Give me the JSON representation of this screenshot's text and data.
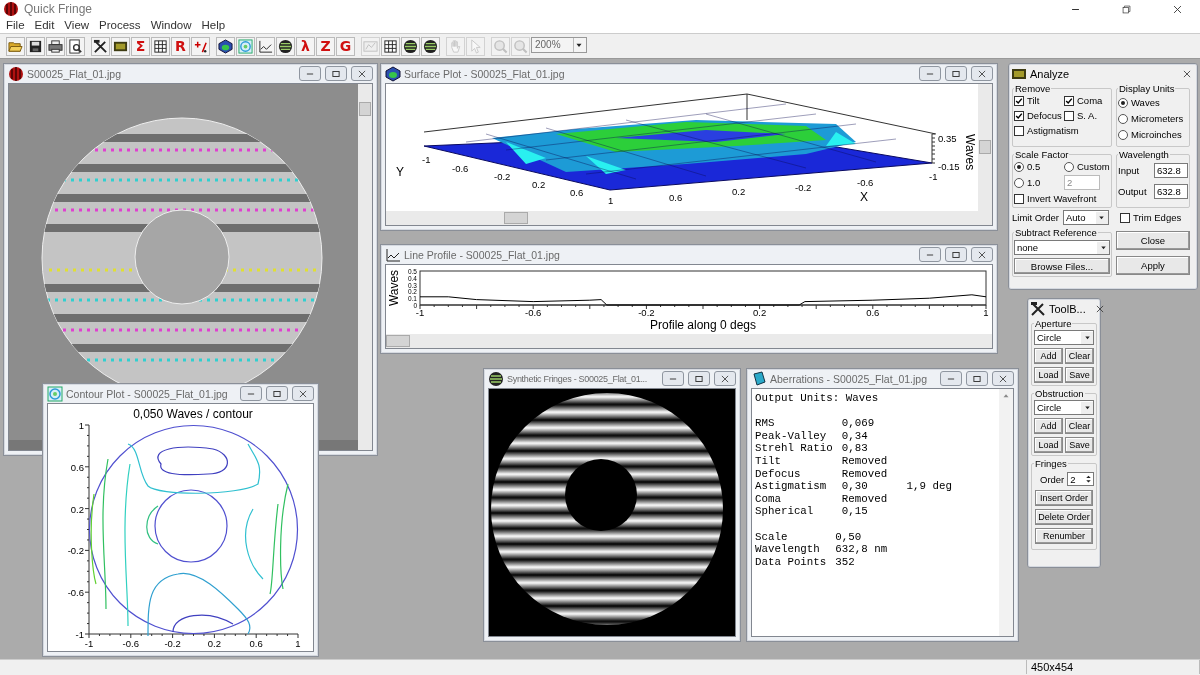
{
  "app": {
    "title": "Quick Fringe"
  },
  "menu": [
    "File",
    "Edit",
    "View",
    "Process",
    "Window",
    "Help"
  ],
  "toolbar": [
    [
      {
        "kind": "icon",
        "disabled": false
      },
      {
        "kind": "icon",
        "disabled": false
      },
      {
        "kind": "icon",
        "disabled": false
      },
      {
        "kind": "icon",
        "disabled": false
      }
    ],
    [
      {
        "kind": "icon",
        "disabled": false
      },
      {
        "kind": "icon",
        "disabled": false
      },
      {
        "kind": "glyph",
        "text": "Σ",
        "disabled": false
      },
      {
        "kind": "icon",
        "disabled": false
      },
      {
        "kind": "glyph",
        "text": "R",
        "disabled": false
      },
      {
        "kind": "icon",
        "disabled": false
      }
    ],
    [
      {
        "kind": "icon",
        "disabled": false
      },
      {
        "kind": "icon",
        "disabled": false
      },
      {
        "kind": "icon",
        "disabled": false
      },
      {
        "kind": "icon",
        "disabled": false
      },
      {
        "kind": "glyph",
        "text": "λ",
        "disabled": false
      },
      {
        "kind": "glyph",
        "text": "Z",
        "disabled": false
      },
      {
        "kind": "glyph",
        "text": "G",
        "disabled": false
      }
    ],
    [
      {
        "kind": "icon",
        "disabled": true
      },
      {
        "kind": "icon",
        "disabled": false
      },
      {
        "kind": "icon",
        "disabled": false
      },
      {
        "kind": "icon",
        "disabled": false
      }
    ],
    [
      {
        "kind": "icon",
        "disabled": true
      },
      {
        "kind": "icon",
        "disabled": true
      }
    ],
    [
      {
        "kind": "icon",
        "disabled": true
      },
      {
        "kind": "icon",
        "disabled": true
      },
      {
        "kind": "combo",
        "text": "200%",
        "disabled": true
      }
    ]
  ],
  "image_window": {
    "title": "S00025_Flat_01.jpg"
  },
  "surface_plot": {
    "title": "Surface Plot - S00025_Flat_01.jpg",
    "y_label": "Y",
    "x_label": "X",
    "z_label": "Waves",
    "y_ticks": [
      "-1",
      "-0.6",
      "-0.2",
      "0.2",
      "0.6",
      "1"
    ],
    "x_ticks": [
      "0.6",
      "0.2",
      "-0.2",
      "-0.6",
      "-1"
    ],
    "z_ticks": [
      "0.35",
      "-0.15"
    ]
  },
  "line_profile": {
    "title": "Line Profile - S00025_Flat_01.jpg",
    "chart_data": {
      "type": "line",
      "xlabel": "Profile along 0 degs",
      "ylabel": "Waves",
      "x": [
        -1,
        -0.9,
        -0.8,
        -0.6,
        -0.4,
        -0.36,
        -0.34,
        0.34,
        0.36,
        0.6,
        0.8,
        0.95,
        1
      ],
      "series": [
        {
          "color": "#000000",
          "values": [
            0.12,
            0.12,
            0.08,
            0.05,
            0.07,
            0.08,
            0,
            0,
            0.05,
            0.07,
            0.1,
            0.15,
            0.12
          ]
        }
      ],
      "xlim": [
        -1,
        1
      ],
      "ylim": [
        0,
        0.5
      ],
      "xticks": [
        -1,
        -0.6,
        -0.2,
        0.2,
        0.6,
        1
      ],
      "yticks": [
        0,
        0.1,
        0.2,
        0.3,
        0.4,
        0.5
      ]
    }
  },
  "contour_plot": {
    "title": "Contour Plot - S00025_Flat_01.jpg",
    "plot_title": "0,050 Waves / contour",
    "xticks": [
      "-1",
      "-0.6",
      "-0.2",
      "0.2",
      "0.6",
      "1"
    ],
    "yticks": [
      "1",
      "0.6",
      "0.2",
      "-0.2",
      "-0.6",
      "-1"
    ]
  },
  "synthetic_fringes": {
    "title": "Synthetic Fringes - S00025_Flat_01..."
  },
  "aberrations": {
    "title": "Aberrations - S00025_Flat_01.jpg",
    "header": "Output Units: Waves",
    "groups": [
      [
        {
          "label": "RMS",
          "value": "0,069"
        },
        {
          "label": "Peak-Valley",
          "value": "0,34"
        },
        {
          "label": "Strehl Ratio",
          "value": "0,83"
        },
        {
          "label": "Tilt",
          "value": "Removed"
        },
        {
          "label": "Defocus",
          "value": "Removed"
        },
        {
          "label": "Astigmatism",
          "value": "0,30",
          "extra": "1,9 deg"
        },
        {
          "label": "Coma",
          "value": "Removed"
        },
        {
          "label": "Spherical",
          "value": "0,15"
        }
      ],
      [
        {
          "label": "Scale",
          "value": "0,50"
        },
        {
          "label": "Wavelength",
          "value": "632,8 nm"
        },
        {
          "label": "Data Points",
          "value": "352"
        }
      ]
    ]
  },
  "analyze": {
    "title": "Analyze",
    "remove": {
      "label": "Remove",
      "options": [
        {
          "label": "Tilt",
          "checked": true
        },
        {
          "label": "Coma",
          "checked": true
        },
        {
          "label": "Defocus",
          "checked": true
        },
        {
          "label": "S. A.",
          "checked": false
        },
        {
          "label": "Astigmatism",
          "checked": false
        }
      ]
    },
    "display_units": {
      "label": "Display Units",
      "options": [
        {
          "label": "Waves",
          "selected": true
        },
        {
          "label": "Micrometers",
          "selected": false
        },
        {
          "label": "Microinches",
          "selected": false
        }
      ]
    },
    "scale_factor": {
      "label": "Scale Factor",
      "options": [
        {
          "label": "0.5",
          "selected": true
        },
        {
          "label": "Custom",
          "selected": false
        },
        {
          "label": "1.0",
          "selected": false
        }
      ],
      "custom_value": "2",
      "invert": {
        "label": "Invert Wavefront",
        "checked": false
      }
    },
    "wavelength": {
      "label": "Wavelength",
      "input_label": "Input",
      "input": "632.8",
      "output_label": "Output",
      "output": "632.8"
    },
    "limit_order": {
      "label": "Limit Order",
      "value": "Auto"
    },
    "trim_edges": {
      "label": "Trim Edges",
      "checked": false
    },
    "subtract_reference": {
      "label": "Subtract Reference",
      "value": "none",
      "browse": "Browse Files..."
    },
    "buttons": [
      "Close",
      "Apply"
    ]
  },
  "toolbox": {
    "title": "ToolB...",
    "aperture": {
      "label": "Aperture",
      "shape": "Circle",
      "buttons": [
        "Add",
        "Clear",
        "Load",
        "Save"
      ]
    },
    "obstruction": {
      "label": "Obstruction",
      "shape": "Circle",
      "buttons": [
        "Add",
        "Clear",
        "Load",
        "Save"
      ]
    },
    "fringes": {
      "label": "Fringes",
      "order_label": "Order",
      "order": "2",
      "buttons": [
        "Insert Order",
        "Delete Order",
        "Renumber"
      ]
    }
  },
  "status_bar": {
    "dimensions": "450x454"
  }
}
